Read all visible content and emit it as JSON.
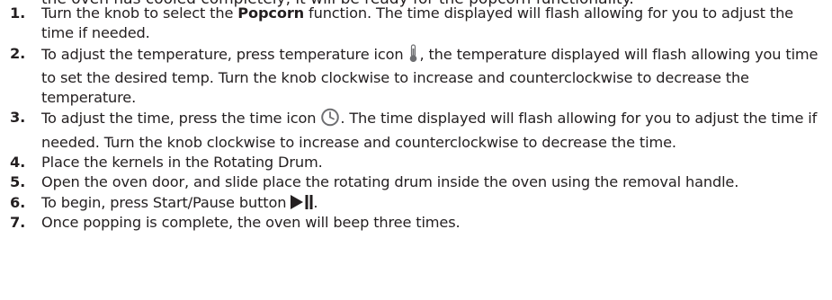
{
  "cut_off_text": "the oven has cooled completely, it will be ready for the popcorn functionality.",
  "steps": [
    {
      "number": "1.",
      "text_before": "Turn the knob to select the ",
      "bold": "Popcorn",
      "text_after": " function. The time displayed will flash allowing for you to adjust the time if needed."
    },
    {
      "number": "2.",
      "text_before": "To adjust the temperature, press temperature icon ",
      "icon": "thermometer-icon",
      "text_after": ", the temperature displayed will flash allowing you time to set the desired temp. Turn the knob clockwise to increase and counterclockwise to decrease the temperature."
    },
    {
      "number": "3.",
      "text_before": "To adjust the time, press the time icon ",
      "icon": "clock-icon",
      "text_after": ". The time displayed will flash allowing for you to adjust the time if needed. Turn the knob clockwise to increase and counterclockwise to decrease the time."
    },
    {
      "number": "4.",
      "text": "Place the kernels in the Rotating Drum."
    },
    {
      "number": "5.",
      "text": "Open the oven door, and slide place the rotating drum inside the oven using the removal handle."
    },
    {
      "number": "6.",
      "text_before": "To begin, press Start/Pause button ",
      "icon": "play-pause-icon",
      "text_after": "."
    },
    {
      "number": "7.",
      "text": "Once popping is complete, the oven will beep three times."
    }
  ]
}
